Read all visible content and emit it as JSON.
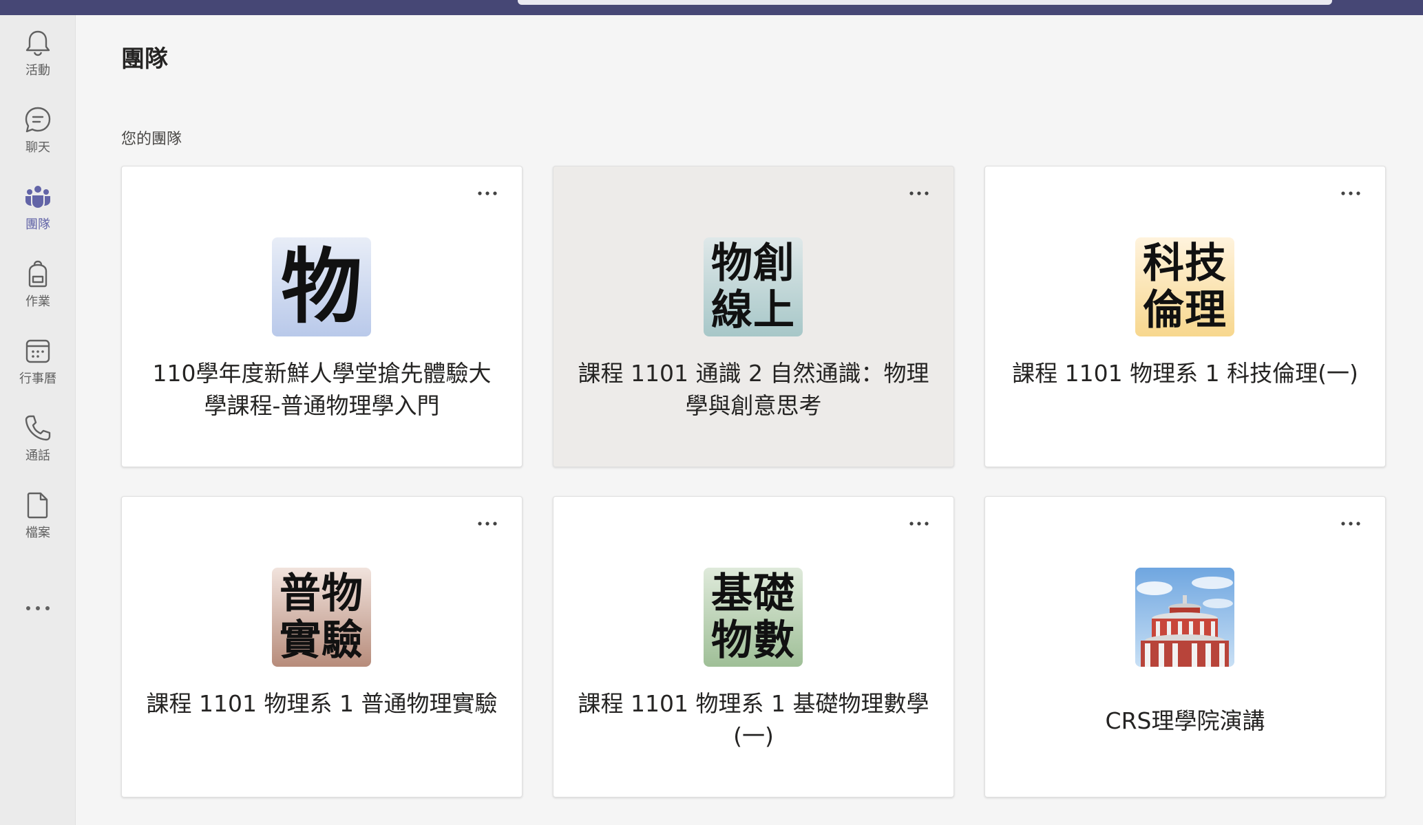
{
  "nav": {
    "items": [
      {
        "label": "活動",
        "icon": "bell-icon"
      },
      {
        "label": "聊天",
        "icon": "chat-icon"
      },
      {
        "label": "團隊",
        "icon": "teams-icon",
        "active": true
      },
      {
        "label": "作業",
        "icon": "backpack-icon"
      },
      {
        "label": "行事曆",
        "icon": "calendar-icon"
      },
      {
        "label": "通話",
        "icon": "phone-icon"
      },
      {
        "label": "檔案",
        "icon": "file-icon"
      }
    ],
    "more_icon": "more-horizontal-icon"
  },
  "header": {
    "title": "團隊"
  },
  "teams_section": {
    "label": "您的團隊",
    "teams": [
      {
        "name": "110學年度新鮮人學堂搶先體驗大學課程-普通物理學入門",
        "tile_lines": [
          "物"
        ],
        "tile_color_top": "#e8edf7",
        "tile_color_bottom": "#b9c9ea"
      },
      {
        "name": "課程 1101 通識 2 自然通識：物理學與創意思考",
        "tile_lines": [
          "物創",
          "線上"
        ],
        "tile_color_top": "#dfe8e9",
        "tile_color_bottom": "#a7c7c8"
      },
      {
        "name": "課程 1101 物理系 1 科技倫理(一)",
        "tile_lines": [
          "科技",
          "倫理"
        ],
        "tile_color_top": "#fff3dd",
        "tile_color_bottom": "#f7d78e"
      },
      {
        "name": "課程 1101 物理系 1 普通物理實驗",
        "tile_lines": [
          "普物",
          "實驗"
        ],
        "tile_color_top": "#f1e3dd",
        "tile_color_bottom": "#b78c7b"
      },
      {
        "name": "課程 1101 物理系 1 基礎物理數學(一)",
        "tile_lines": [
          "基礎",
          "物數"
        ],
        "tile_color_top": "#dfeadb",
        "tile_color_bottom": "#9fbf97"
      },
      {
        "name": "CRS理學院演講",
        "tile_lines": [],
        "tile_image": "building-photo"
      }
    ]
  }
}
